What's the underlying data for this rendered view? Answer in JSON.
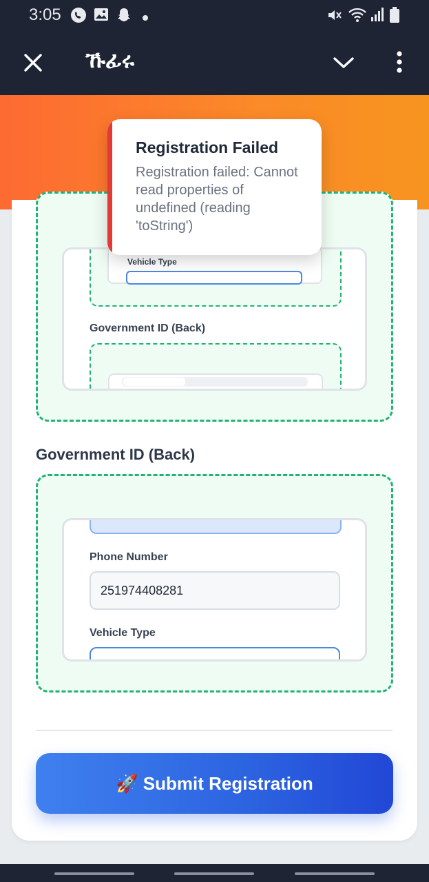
{
  "status_bar": {
    "time": "3:05",
    "left_icons": [
      "viber-icon",
      "image-icon",
      "snapchat-icon",
      "dot-icon"
    ],
    "right_icons": [
      "mute-icon",
      "wifi-icon",
      "signal-icon",
      "battery-icon"
    ]
  },
  "app_bar": {
    "title": "ኹፊሩ",
    "icons": [
      "close-icon",
      "chevron-down-icon",
      "more-vert-icon"
    ]
  },
  "toast": {
    "title": "Registration Failed",
    "message": "Registration failed: Cannot read properties of undefined (reading 'toString')",
    "accent_color": "#e53935"
  },
  "preview_top": {
    "inner_label": "Vehicle Type",
    "label": "Government ID (Back)"
  },
  "section": {
    "title": "Government ID (Back)"
  },
  "preview_bottom": {
    "phone_label": "Phone Number",
    "phone_value": "251974408281",
    "vehicle_label": "Vehicle Type"
  },
  "submit": {
    "icon": "rocket-icon",
    "label": "🚀 Submit Registration"
  },
  "colors": {
    "header_bg": "#1e2433",
    "orange": "#fb8a28",
    "dashed_green": "#1fb374",
    "button_blue": "#2c63e0"
  }
}
